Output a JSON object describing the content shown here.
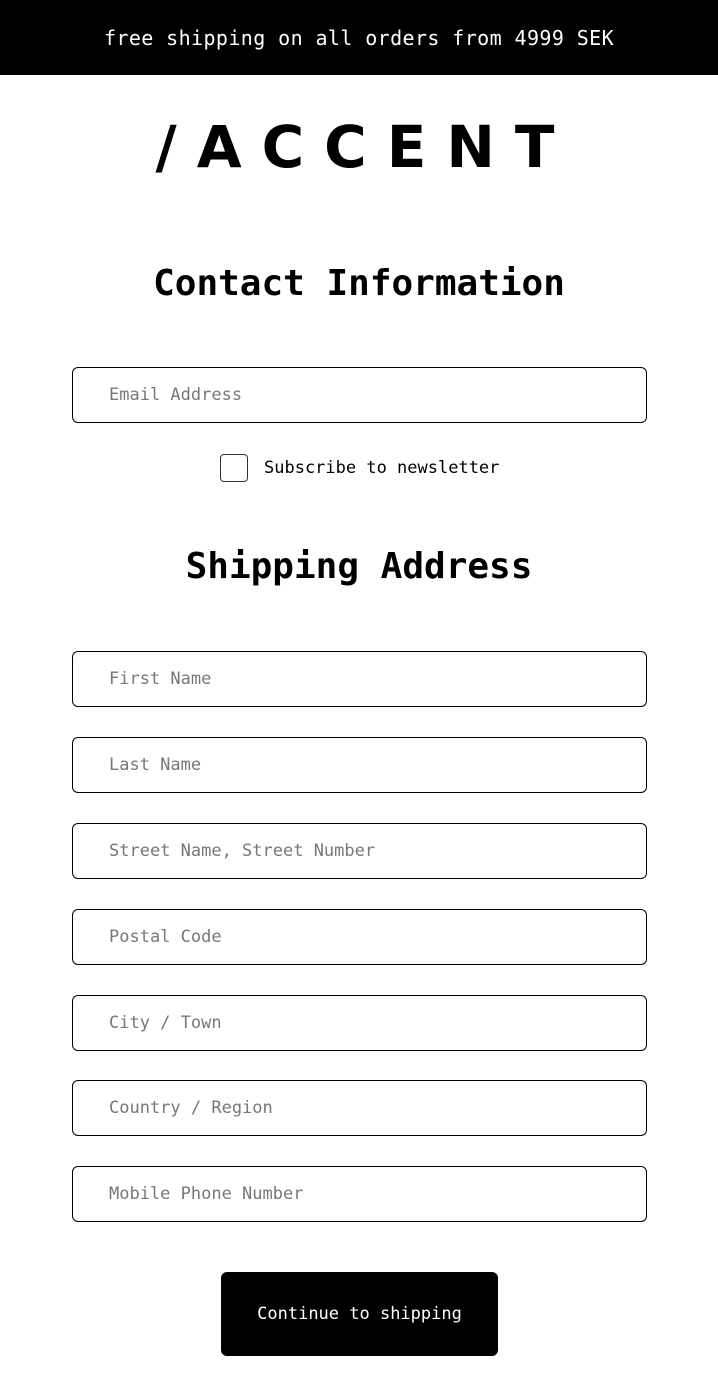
{
  "announcement": {
    "text": "free shipping on all orders from 4999 SEK"
  },
  "brand": {
    "logo_text": "/ACCENT"
  },
  "contact": {
    "heading": "Contact Information",
    "email_placeholder": "Email Address",
    "newsletter_label": "Subscribe to newsletter",
    "newsletter_checked": false
  },
  "shipping": {
    "heading": "Shipping Address",
    "fields": [
      {
        "placeholder": "First Name"
      },
      {
        "placeholder": "Last Name"
      },
      {
        "placeholder": "Street Name, Street Number"
      },
      {
        "placeholder": "Postal Code"
      },
      {
        "placeholder": "City / Town"
      },
      {
        "placeholder": "Country / Region"
      },
      {
        "placeholder": "Mobile Phone Number"
      }
    ]
  },
  "actions": {
    "continue_label": "Continue to shipping"
  }
}
